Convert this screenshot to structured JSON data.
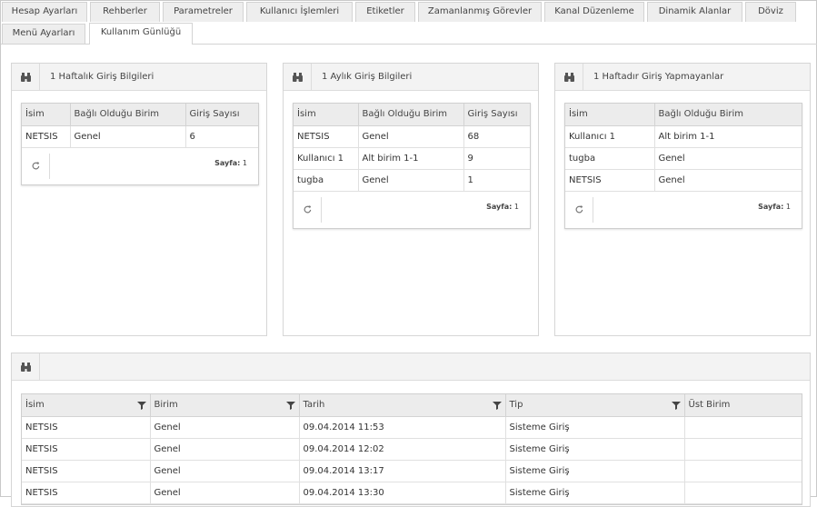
{
  "tabs": {
    "row1": [
      "Hesap Ayarları",
      "Rehberler",
      "Parametreler",
      "Kullanıcı İşlemleri",
      "Etiketler",
      "Zamanlanmış Görevler",
      "Kanal Düzenleme",
      "Dinamik Alanlar",
      "Döviz"
    ],
    "row2": [
      "Menü Ayarları",
      "Kullanım Günlüğü"
    ],
    "active": "Kullanım Günlüğü"
  },
  "weekly_logins": {
    "title": "1 Haftalık Giriş Bilgileri",
    "columns": [
      "İsim",
      "Bağlı Olduğu Birim",
      "Giriş Sayısı"
    ],
    "rows": [
      [
        "NETSIS",
        "Genel",
        "6"
      ]
    ],
    "page_label": "Sayfa:",
    "page_number": "1"
  },
  "monthly_logins": {
    "title": "1 Aylık Giriş Bilgileri",
    "columns": [
      "İsim",
      "Bağlı Olduğu Birim",
      "Giriş Sayısı"
    ],
    "rows": [
      [
        "NETSIS",
        "Genel",
        "68"
      ],
      [
        "Kullanıcı 1",
        "Alt birim 1-1",
        "9"
      ],
      [
        "tugba",
        "Genel",
        "1"
      ]
    ],
    "page_label": "Sayfa:",
    "page_number": "1"
  },
  "inactive_week": {
    "title": "1 Haftadır Giriş Yapmayanlar",
    "columns": [
      "İsim",
      "Bağlı Olduğu Birim"
    ],
    "rows": [
      [
        "Kullanıcı 1",
        "Alt birim 1-1"
      ],
      [
        "tugba",
        "Genel"
      ],
      [
        "NETSIS",
        "Genel"
      ]
    ],
    "page_label": "Sayfa:",
    "page_number": "1"
  },
  "log": {
    "columns": [
      "İsim",
      "Birim",
      "Tarih",
      "Tip",
      "Üst Birim"
    ],
    "rows": [
      [
        "NETSIS",
        "Genel",
        "09.04.2014 11:53",
        "Sisteme Giriş",
        ""
      ],
      [
        "NETSIS",
        "Genel",
        "09.04.2014 12:02",
        "Sisteme Giriş",
        ""
      ],
      [
        "NETSIS",
        "Genel",
        "09.04.2014 13:17",
        "Sisteme Giriş",
        ""
      ],
      [
        "NETSIS",
        "Genel",
        "09.04.2014 13:30",
        "Sisteme Giriş",
        ""
      ]
    ]
  },
  "icons": {
    "panel": "binoculars-icon",
    "refresh": "refresh-icon",
    "filter": "filter-icon"
  },
  "colors": {
    "header_bg": "#f3f3f3",
    "tab_bg": "#eeeeee",
    "border": "#d6d6d6"
  }
}
